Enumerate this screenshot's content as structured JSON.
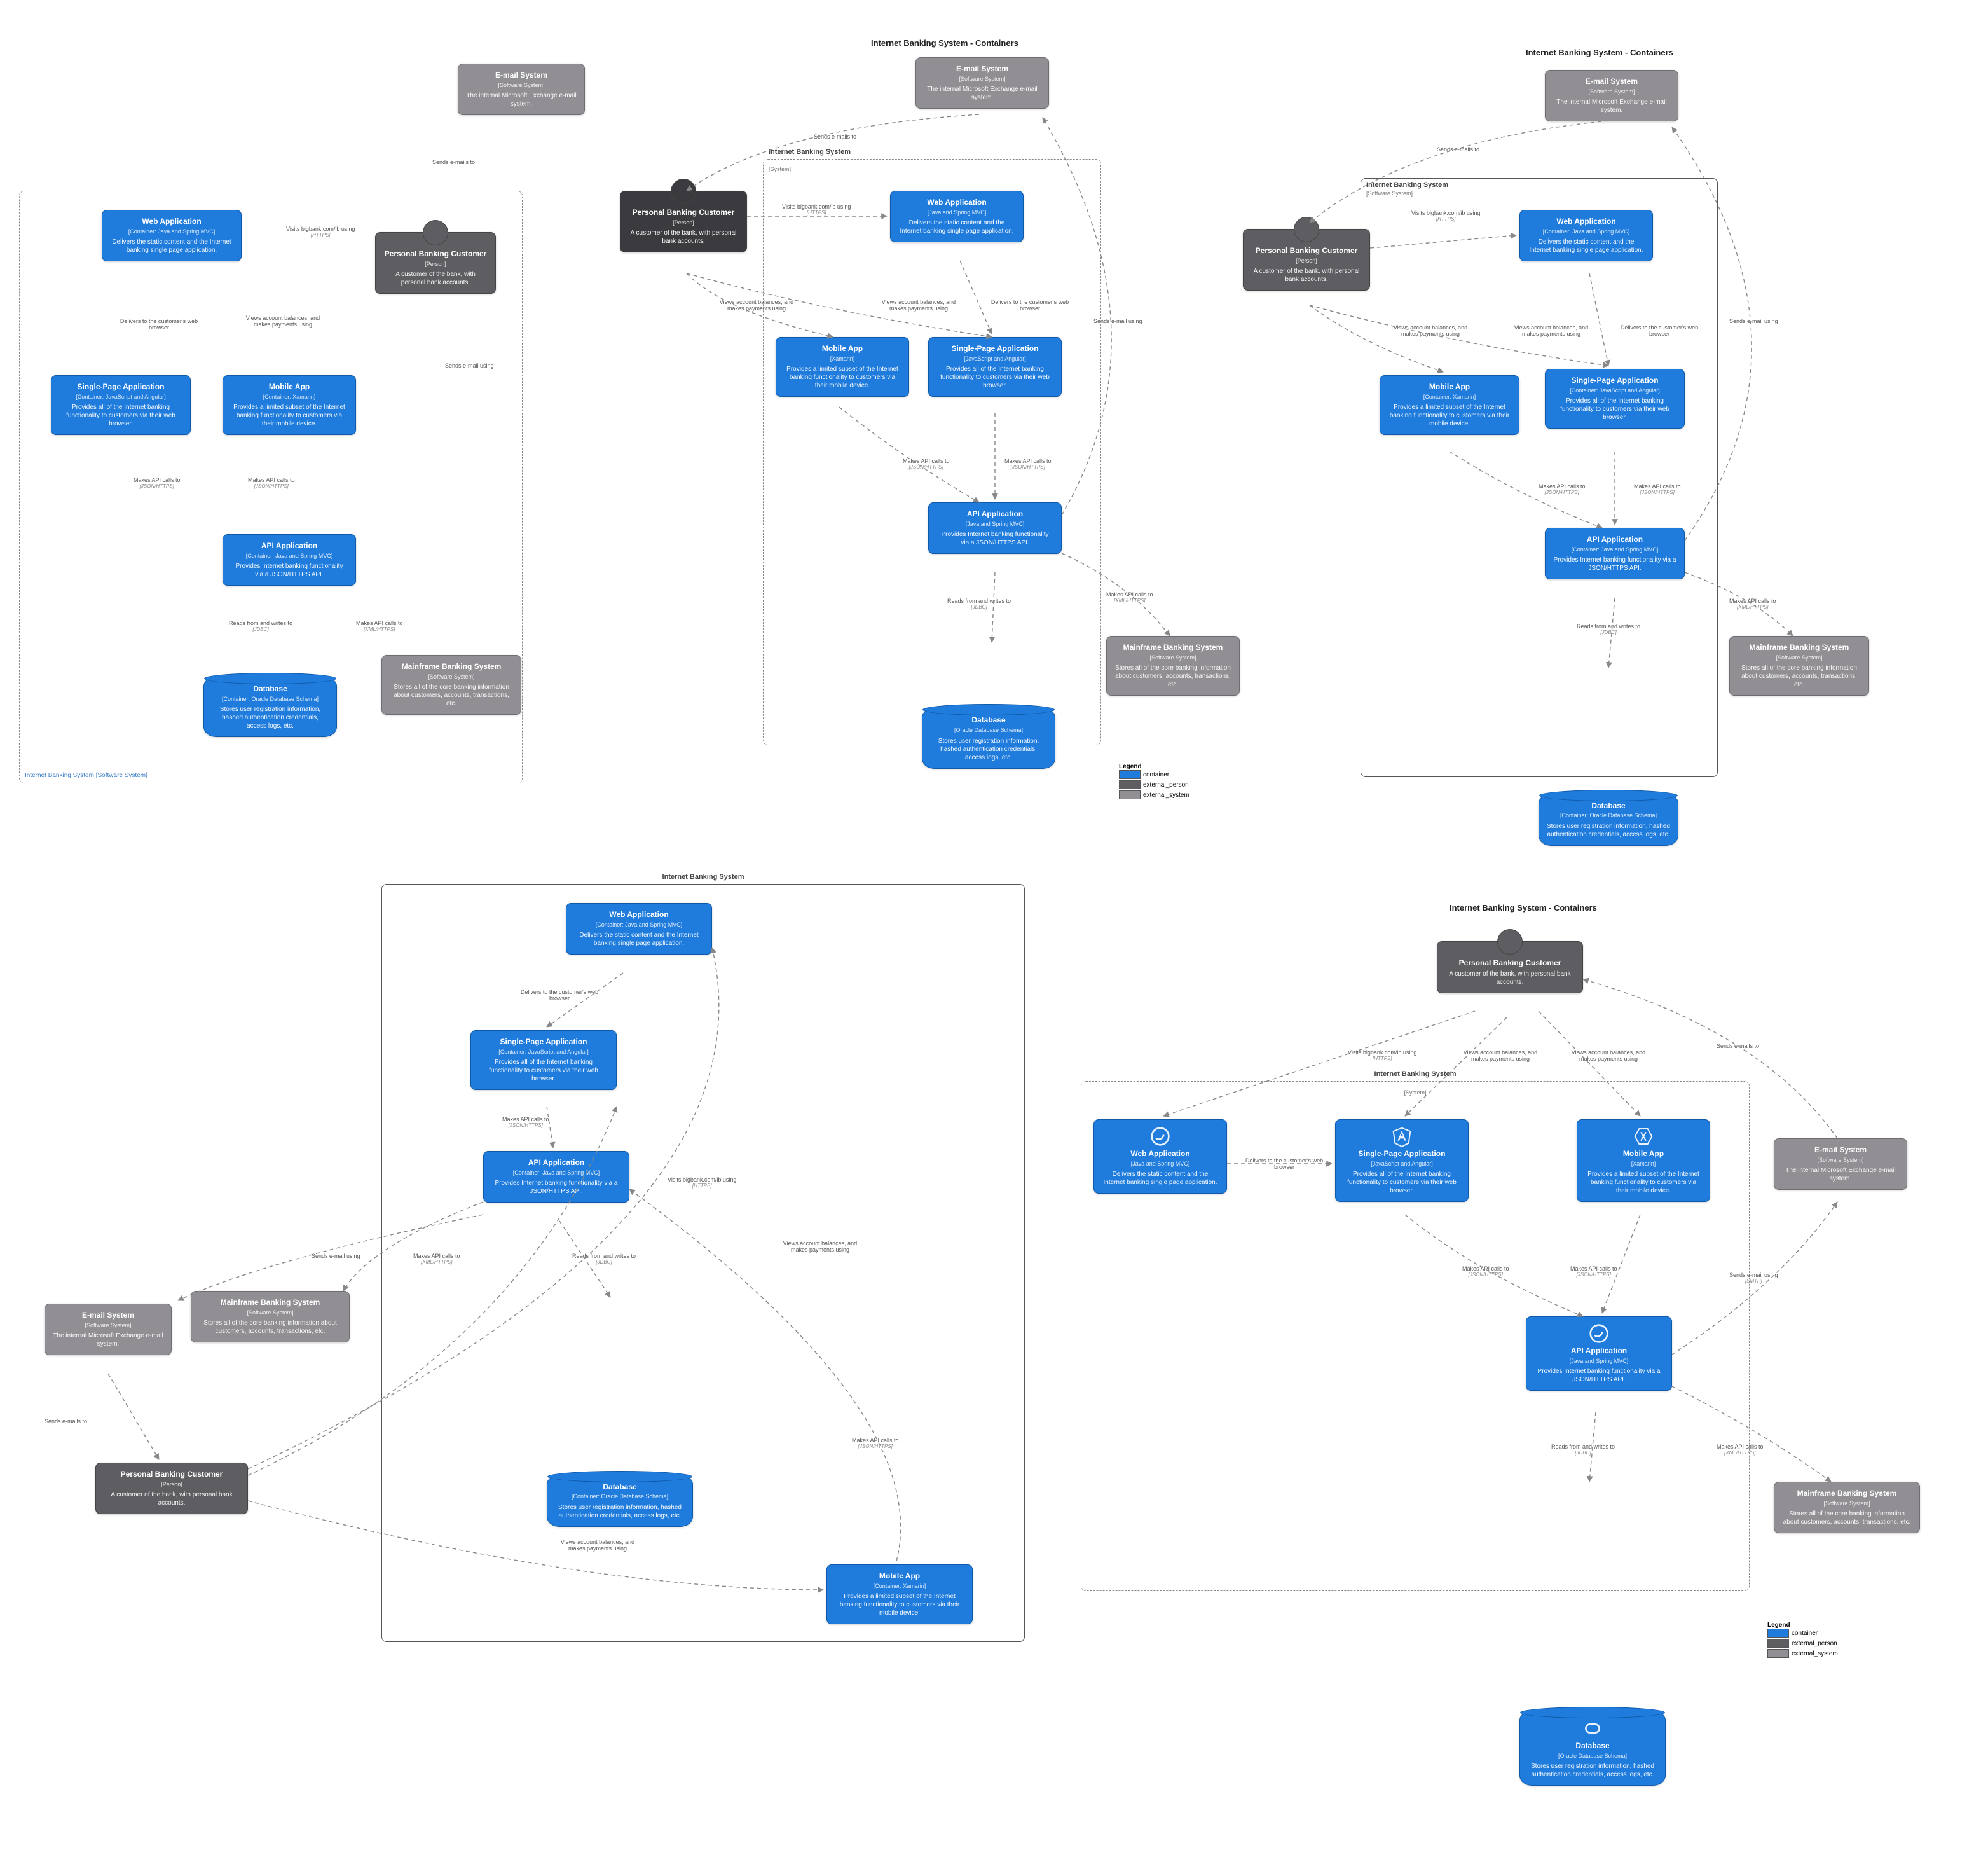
{
  "diagrams_count": 5,
  "shared_title": "Internet Banking System - Containers",
  "actors": {
    "customer": {
      "title": "Personal Banking Customer",
      "subtype": "[Person]",
      "desc": "A customer of the bank, with personal bank accounts."
    }
  },
  "external_systems": {
    "email": {
      "title": "E-mail System",
      "subtype": "[Software System]",
      "desc": "The internal Microsoft Exchange e-mail system."
    },
    "mainframe": {
      "title": "Mainframe Banking System",
      "subtype": "[Software System]",
      "desc": "Stores all of the core banking information about customers, accounts, transactions, etc."
    }
  },
  "boundary": {
    "name": "Internet Banking System",
    "subtype_system": "[System]",
    "subtype_software_system": "[Software System]"
  },
  "containers": {
    "web": {
      "title": "Web Application",
      "subtype": "[Container: Java and Spring MVC]",
      "subtype_short": "[Java and Spring MVC]",
      "desc": "Delivers the static content and the Internet banking single page application."
    },
    "spa": {
      "title": "Single-Page Application",
      "subtype": "[Container: JavaScript and Angular]",
      "subtype_short": "[JavaScript and Angular]",
      "desc": "Provides all of the Internet banking functionality to customers via their web browser."
    },
    "mobile": {
      "title": "Mobile App",
      "subtype": "[Container: Xamarin]",
      "subtype_short": "[Xamarin]",
      "desc": "Provides a limited subset of the Internet banking functionality to customers via their mobile device."
    },
    "api": {
      "title": "API Application",
      "subtype": "[Container: Java and Spring MVC]",
      "subtype_short": "[Java and Spring MVC]",
      "desc": "Provides Internet banking functionality via a JSON/HTTPS API."
    },
    "db": {
      "title": "Database",
      "subtype": "[Container: Oracle Database Schema]",
      "subtype_short": "[Oracle Database Schema]",
      "desc": "Stores user registration information, hashed authentication credentials, access logs, etc."
    }
  },
  "relations": {
    "email_to_customer": {
      "label": "Sends e-mails to",
      "tech": ""
    },
    "customer_to_web": {
      "label": "Visits bigbank.com/ib using",
      "tech": "[HTTPS]"
    },
    "customer_to_spa": {
      "label": "Views account balances, and makes payments using",
      "tech": ""
    },
    "customer_to_mobile": {
      "label": "Views account balances, and makes payments using",
      "tech": ""
    },
    "web_to_spa": {
      "label": "Delivers to the customer's web browser",
      "tech": ""
    },
    "spa_to_api": {
      "label": "Makes API calls to",
      "tech": "[JSON/HTTPS]"
    },
    "mobile_to_api": {
      "label": "Makes API calls to",
      "tech": "[JSON/HTTPS]"
    },
    "api_to_db": {
      "label": "Reads from and writes to",
      "tech": "[JDBC]"
    },
    "api_to_mainframe": {
      "label": "Makes API calls to",
      "tech": "[XML/HTTPS]"
    },
    "api_to_email": {
      "label": "Sends e-mail using",
      "tech": "[SMTP]"
    }
  },
  "legend": {
    "title": "Legend",
    "items": [
      {
        "kind": "container",
        "label": "container",
        "color": "#1f7cdc"
      },
      {
        "kind": "external_person",
        "label": "external_person",
        "color": "#5d5d62"
      },
      {
        "kind": "external_system",
        "label": "external_system",
        "color": "#918f93"
      }
    ]
  },
  "boundary_caption_bottomleft": "Internet Banking System\n[Software System]"
}
